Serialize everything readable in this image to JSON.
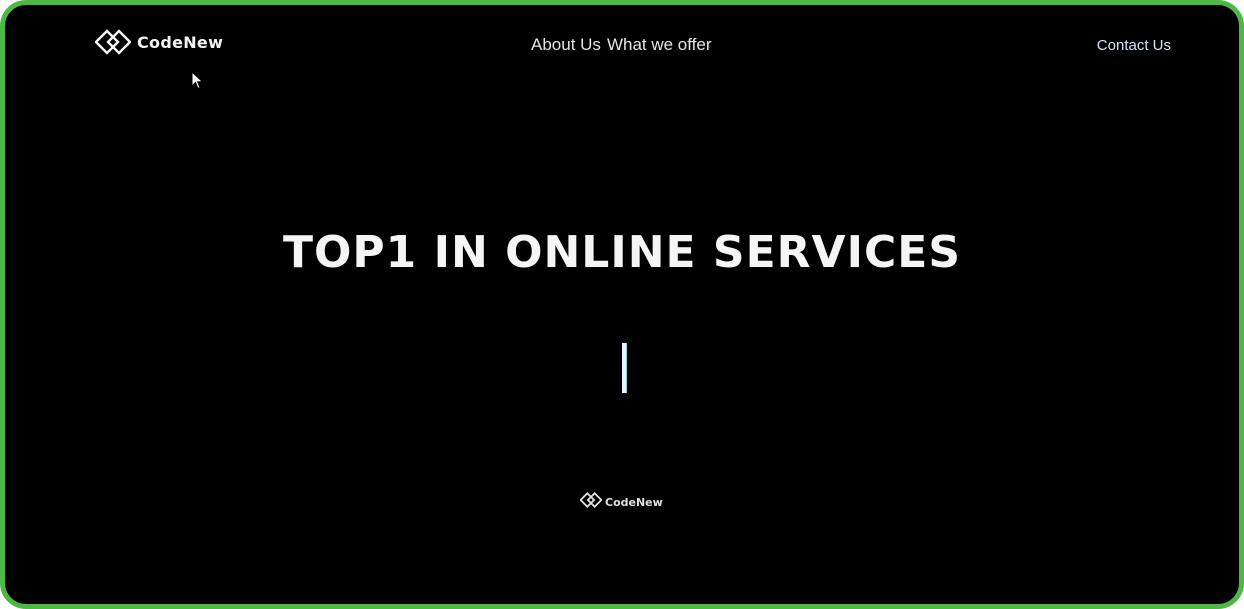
{
  "header": {
    "logo": {
      "icon": "diamond-logo-icon",
      "text": "CodeNew"
    },
    "nav": {
      "about_label": "About Us",
      "offer_label": "What we offer"
    },
    "contact_label": "Contact Us"
  },
  "hero": {
    "title": "TOP1 IN ONLINE SERVICES",
    "caret_icon": "text-caret-icon"
  },
  "footer": {
    "logo": {
      "icon": "diamond-logo-icon",
      "text": "CodeNew"
    }
  },
  "colors": {
    "background": "#000000",
    "frame_border": "#4cb944",
    "text": "#f5f5f5",
    "contact": "#cfe6ff"
  }
}
